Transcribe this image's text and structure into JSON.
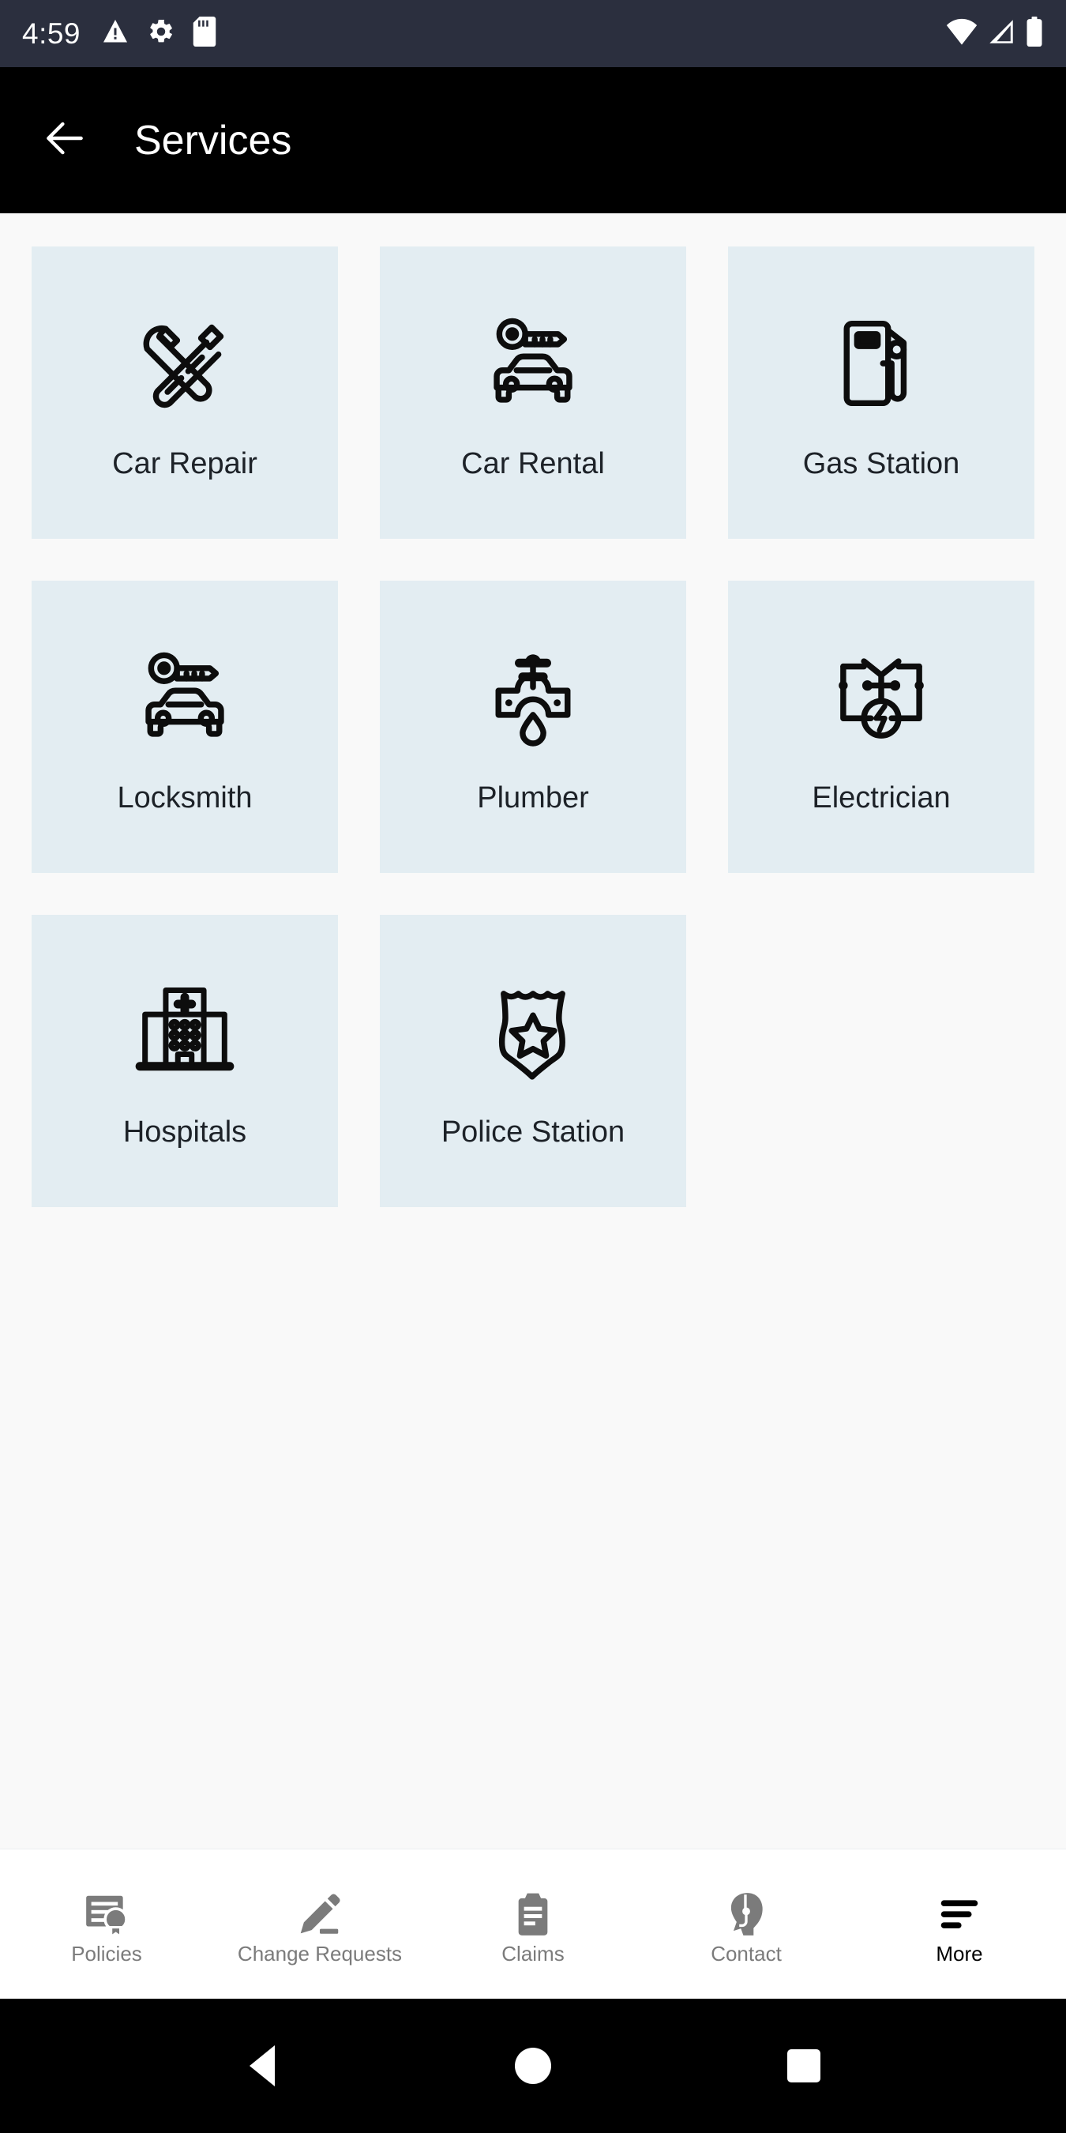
{
  "status_bar": {
    "time": "4:59",
    "left_icons": [
      "warning-icon",
      "gear-icon",
      "sd-card-icon"
    ],
    "right_icons": [
      "wifi-icon",
      "cellular-signal-icon",
      "battery-icon"
    ],
    "background_color": "#2b2f3e"
  },
  "app_bar": {
    "title": "Services",
    "back_icon": "arrow-left-icon",
    "background_color": "#000000",
    "text_color": "#ffffff"
  },
  "content": {
    "background_color": "#f9f9f9",
    "card_color": "#e3edf2",
    "label_color": "#1d2228",
    "services": [
      {
        "label": "Car Repair",
        "icon": "wrench-screwdriver-icon"
      },
      {
        "label": "Car Rental",
        "icon": "key-car-icon"
      },
      {
        "label": "Gas Station",
        "icon": "fuel-pump-icon"
      },
      {
        "label": "Locksmith",
        "icon": "key-car-icon"
      },
      {
        "label": "Plumber",
        "icon": "pipe-valve-drop-icon"
      },
      {
        "label": "Electrician",
        "icon": "circuit-bolt-icon"
      },
      {
        "label": "Hospitals",
        "icon": "hospital-building-icon"
      },
      {
        "label": "Police Station",
        "icon": "police-badge-star-icon"
      }
    ]
  },
  "bottom_nav": {
    "active_index": 4,
    "inactive_color": "#7b7b7b",
    "active_color": "#000000",
    "items": [
      {
        "label": "Policies",
        "icon": "certificate-icon"
      },
      {
        "label": "Change Requests",
        "icon": "pencil-edit-icon"
      },
      {
        "label": "Claims",
        "icon": "clipboard-icon"
      },
      {
        "label": "Contact",
        "icon": "headset-support-icon"
      },
      {
        "label": "More",
        "icon": "hamburger-menu-icon"
      }
    ]
  },
  "system_nav": {
    "background_color": "#000000",
    "buttons": [
      {
        "name": "back",
        "icon": "triangle-back-icon"
      },
      {
        "name": "home",
        "icon": "circle-home-icon"
      },
      {
        "name": "recent",
        "icon": "square-recents-icon"
      }
    ]
  }
}
